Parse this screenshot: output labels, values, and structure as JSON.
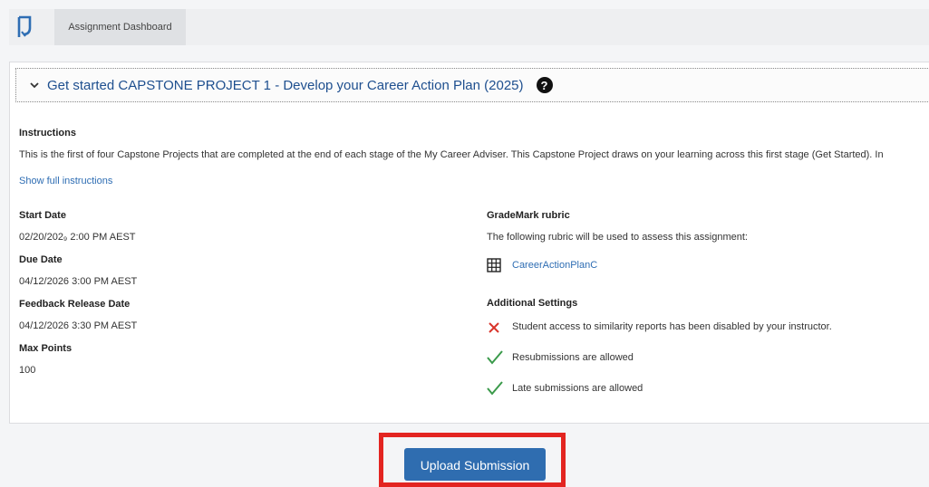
{
  "header": {
    "tab_label": "Assignment Dashboard"
  },
  "assignment": {
    "title": "Get started CAPSTONE PROJECT 1 - Develop your Career Action Plan (2025)",
    "help_glyph": "?"
  },
  "instructions": {
    "heading": "Instructions",
    "text": "This is the first of four Capstone Projects that are completed at the end of each stage of the My Career Adviser. This Capstone Project draws on your learning across this first stage (Get Started). In",
    "show_full_link": "Show full instructions"
  },
  "dates": {
    "start_label": "Start Date",
    "start_value": "02/20/202₉ 2:00 PM AEST",
    "due_label": "Due Date",
    "due_value": "04/12/2026 3:00 PM AEST",
    "feedback_label": "Feedback Release Date",
    "feedback_value": "04/12/2026 3:30 PM AEST",
    "max_points_label": "Max Points",
    "max_points_value": "100"
  },
  "rubric": {
    "heading": "GradeMark rubric",
    "description": "The following rubric will be used to assess this assignment:",
    "link_label": "CareerActionPlanC"
  },
  "settings": {
    "heading": "Additional Settings",
    "items": [
      {
        "text": "Student access to similarity reports has been disabled by your instructor.",
        "status": "disabled",
        "icon": "x-icon"
      },
      {
        "text": "Resubmissions are allowed",
        "status": "enabled",
        "icon": "check-icon"
      },
      {
        "text": "Late submissions are allowed",
        "status": "enabled",
        "icon": "check-icon"
      }
    ]
  },
  "actions": {
    "upload_label": "Upload Submission"
  },
  "colors": {
    "link": "#2e6db3",
    "title": "#1e4f8f",
    "button": "#2f6db0",
    "highlight": "#e32521",
    "cross": "#d9342b",
    "check": "#3a9a4a"
  }
}
